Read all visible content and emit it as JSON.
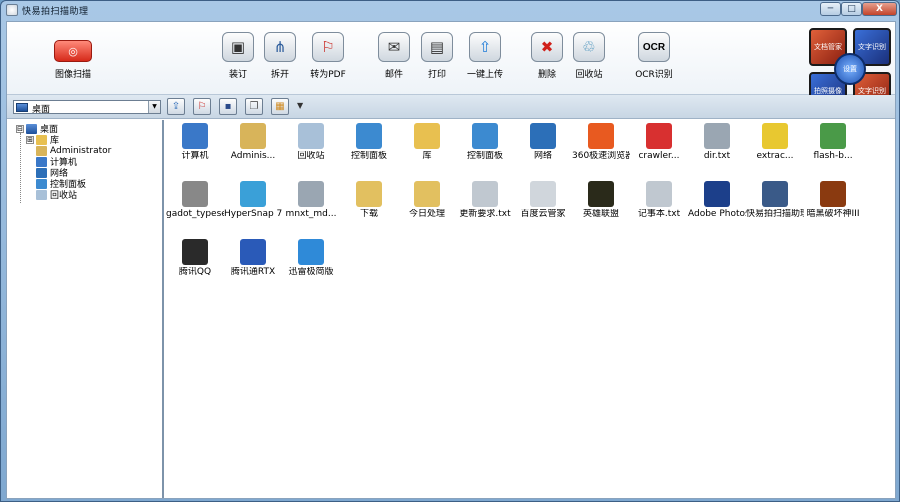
{
  "window": {
    "title": "快易拍扫描助理",
    "controls": {
      "minimize": "─",
      "maximize": "□",
      "close": "X"
    }
  },
  "toolbar": {
    "scan_label": "图像扫描",
    "buttons": [
      {
        "label": "装订"
      },
      {
        "label": "拆开"
      },
      {
        "label": "转为PDF"
      },
      {
        "label": "邮件"
      },
      {
        "label": "打印"
      },
      {
        "label": "一键上传"
      },
      {
        "label": "删除"
      },
      {
        "label": "回收站"
      },
      {
        "label": "OCR识别",
        "icon_text": "OCR"
      }
    ]
  },
  "corner_menu": {
    "q1": "文档管家",
    "q2": "文字识别",
    "q3": "拍照摄像",
    "q4": "文字识别",
    "center": "设置"
  },
  "location_combo": {
    "value": "桌面"
  },
  "tree": {
    "items": [
      {
        "label": "桌面",
        "expander": "⊟"
      },
      {
        "label": "库",
        "expander": "⊞"
      },
      {
        "label": "Administrator"
      },
      {
        "label": "计算机"
      },
      {
        "label": "网络"
      },
      {
        "label": "控制面板"
      },
      {
        "label": "回收站"
      }
    ]
  },
  "files": [
    {
      "label": "计算机",
      "icon": "computer-icon",
      "color": "#3a78c8"
    },
    {
      "label": "Adminis...",
      "icon": "user-folder-icon",
      "color": "#d8b45a"
    },
    {
      "label": "回收站",
      "icon": "recycle-bin-icon",
      "color": "#a8c0d8"
    },
    {
      "label": "控制面板",
      "icon": "control-panel-icon",
      "color": "#3c8ad0"
    },
    {
      "label": "库",
      "icon": "library-icon",
      "color": "#e8c050"
    },
    {
      "label": "控制面板",
      "icon": "control-panel-icon",
      "color": "#3c8ad0"
    },
    {
      "label": "网络",
      "icon": "network-icon",
      "color": "#2c6fb8"
    },
    {
      "label": "360极速浏览器",
      "icon": "browser-360-icon",
      "color": "#e85a20"
    },
    {
      "label": "crawler...",
      "icon": "crawler-icon",
      "color": "#d83030"
    },
    {
      "label": "dir.txt",
      "icon": "text-file-icon",
      "color": "#9aa6b2"
    },
    {
      "label": "extrac...",
      "icon": "extract-icon",
      "color": "#e8c830"
    },
    {
      "label": "flash-b...",
      "icon": "flash-icon",
      "color": "#4a9a48"
    },
    {
      "label": "gadot_typeset...",
      "icon": "pen-tool-icon",
      "color": "#888888"
    },
    {
      "label": "HyperSnap 7",
      "icon": "hypersnap-icon",
      "color": "#3aa0d8"
    },
    {
      "label": "mnxt_md...",
      "icon": "text-file-icon",
      "color": "#9aa6b2"
    },
    {
      "label": "下载",
      "icon": "folder-icon",
      "color": "#e2c060"
    },
    {
      "label": "今日处理",
      "icon": "folder-icon",
      "color": "#e2c060"
    },
    {
      "label": "更新要求.txt",
      "icon": "text-file-icon",
      "color": "#c0c8d0"
    },
    {
      "label": "百度云管家",
      "icon": "blank-file-icon",
      "color": "#d0d6dc"
    },
    {
      "label": "英雄联盟",
      "icon": "lol-icon",
      "color": "#2a2a1a"
    },
    {
      "label": "记事本.txt",
      "icon": "text-file-icon",
      "color": "#c0c8d0"
    },
    {
      "label": "Adobe Photos...",
      "icon": "photoshop-icon",
      "color": "#1c3f8a"
    },
    {
      "label": "快易拍扫描助理",
      "icon": "scanner-app-icon",
      "color": "#3a5a88"
    },
    {
      "label": "暗黑破坏神III",
      "icon": "diablo-icon",
      "color": "#8a3a10"
    },
    {
      "label": "腾讯QQ",
      "icon": "qq-icon",
      "color": "#2a2a2a"
    },
    {
      "label": "腾讯通RTX",
      "icon": "rtx-icon",
      "color": "#2a5ab8"
    },
    {
      "label": "迅雷极简版",
      "icon": "thunder-icon",
      "color": "#2f8ad8"
    }
  ]
}
